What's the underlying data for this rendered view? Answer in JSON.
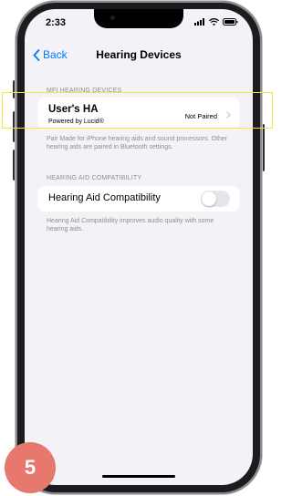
{
  "status_bar": {
    "time": "2:33"
  },
  "nav": {
    "back_label": "Back",
    "title": "Hearing Devices"
  },
  "mfi_section": {
    "header": "MFI HEARING DEVICES",
    "device_name": "User's HA",
    "device_subtitle": "Powered by Lucid®",
    "device_status": "Not Paired",
    "footer": "Pair Made for iPhone hearing aids and sound processors. Other hearing aids are paired in Bluetooth settings."
  },
  "compat_section": {
    "header": "HEARING AID COMPATIBILITY",
    "label": "Hearing Aid Compatibility",
    "toggle_state": "off",
    "footer": "Hearing Aid Compatibility improves audio quality with some hearing aids."
  },
  "annotation": {
    "step_number": "5",
    "highlight_color": "#f2e73f",
    "badge_color": "#e8776e"
  },
  "colors": {
    "accent": "#007aff",
    "background": "#f2f2f7",
    "secondary_text": "#8e8e93"
  }
}
